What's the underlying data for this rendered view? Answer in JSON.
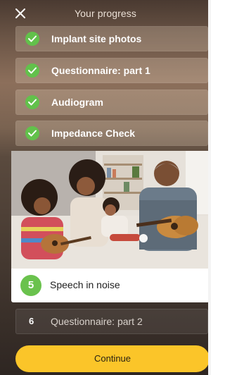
{
  "header": {
    "title": "Your progress",
    "close_icon": "close-icon"
  },
  "completed_steps": [
    {
      "label": "Implant site photos",
      "status": "completed",
      "icon": "check-icon"
    },
    {
      "label": "Questionnaire: part 1",
      "status": "completed",
      "icon": "check-icon"
    },
    {
      "label": "Audiogram",
      "status": "completed",
      "icon": "check-icon"
    },
    {
      "label": "Impedance Check",
      "status": "completed",
      "icon": "check-icon"
    }
  ],
  "current_step": {
    "number": "5",
    "label": "Speech in noise",
    "status": "current"
  },
  "upcoming_step": {
    "number": "6",
    "label": "Questionnaire: part 2",
    "status": "upcoming"
  },
  "continue_label": "Continue",
  "colors": {
    "accent_green": "#62c14b",
    "continue_yellow": "#fbc529",
    "card_white": "#ffffff"
  }
}
